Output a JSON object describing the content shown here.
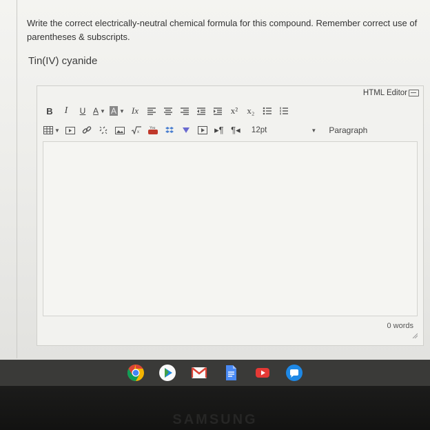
{
  "question": {
    "prompt": "Write the correct electrically-neutral chemical formula for this compound. Remember correct use of parentheses & subscripts.",
    "compound": "Tin(IV) cyanide"
  },
  "editor": {
    "html_editor_label": "HTML Editor",
    "toolbar": {
      "bold": "B",
      "italic": "I",
      "underline": "U",
      "text_color": "A",
      "background_color": "A",
      "clear_formatting": "Ix",
      "superscript": "x²",
      "subscript": "x₂",
      "font_size": "12pt",
      "block_format": "Paragraph"
    },
    "word_count": "0 words"
  },
  "shelf": {
    "apps": [
      "chrome-icon",
      "play-store-icon",
      "gmail-icon",
      "docs-icon",
      "youtube-icon",
      "messages-icon"
    ]
  },
  "bezel": {
    "brand": "SAMSUNG"
  },
  "colors": {
    "chrome_red": "#db4437",
    "chrome_green": "#0f9d58",
    "chrome_yellow": "#f4b400",
    "chrome_blue": "#4285f4",
    "youtube_red": "#e53935",
    "docs_blue": "#4a8af4",
    "messages_blue": "#1e88e5"
  }
}
